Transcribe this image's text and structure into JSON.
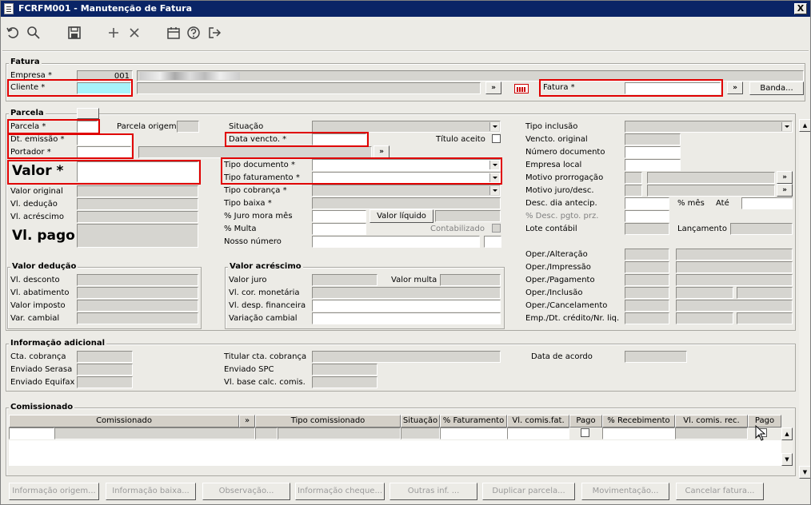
{
  "window": {
    "title": "FCRFM001 - Manutenção de Fatura",
    "close": "X"
  },
  "toolbar": {
    "icons": [
      "undo-icon",
      "search-icon",
      "save-icon",
      "add-icon",
      "delete-icon",
      "calendar-icon",
      "help-icon",
      "exit-icon"
    ]
  },
  "fatura": {
    "section": "Fatura",
    "empresa_label": "Empresa *",
    "empresa_value": "001",
    "cliente_label": "Cliente *",
    "fatura_label": "Fatura *",
    "banda_button": "Banda...",
    "lookup": "»"
  },
  "parcela": {
    "section": "Parcela",
    "parcela_label": "Parcela *",
    "parcela_origem_label": "Parcela origem",
    "dt_emissao_label": "Dt. emissão *",
    "portador_label": "Portador *",
    "valor_label": "Valor *",
    "valor_original_label": "Valor original",
    "vl_deducao_label": "Vl. dedução",
    "vl_acrescimo_label": "Vl. acréscimo",
    "vl_pago_label": "Vl. pago",
    "situacao_label": "Situação",
    "data_vencto_label": "Data vencto. *",
    "titulo_aceito_label": "Título aceito",
    "tipo_documento_label": "Tipo documento *",
    "tipo_faturamento_label": "Tipo faturamento *",
    "tipo_cobranca_label": "Tipo cobrança *",
    "tipo_baixa_label": "Tipo baixa *",
    "juro_mora_label": "% Juro mora mês",
    "valor_liquido_label": "Valor líquido",
    "multa_label": "% Multa",
    "contabilizado_label": "Contabilizado",
    "nosso_numero_label": "Nosso número",
    "tipo_inclusao_label": "Tipo inclusão",
    "vencto_original_label": "Vencto. original",
    "numero_documento_label": "Número documento",
    "empresa_local_label": "Empresa local",
    "motivo_prorrogacao_label": "Motivo prorrogação",
    "motivo_juro_label": "Motivo juro/desc.",
    "desc_dia_label": "Desc. dia antecip.",
    "pct_mes_label": "% mês",
    "ate_label": "Até",
    "pct_desc_label": "% Desc. pgto. prz.",
    "lote_contabil_label": "Lote contábil",
    "lancamento_label": "Lançamento",
    "oper_alteracao_label": "Oper./Alteração",
    "oper_impressao_label": "Oper./Impressão",
    "oper_pagamento_label": "Oper./Pagamento",
    "oper_inclusao_label": "Oper./Inclusão",
    "oper_cancelamento_label": "Oper./Cancelamento",
    "emp_dt_label": "Emp./Dt. crédito/Nr. liq."
  },
  "valor_deducao": {
    "section": "Valor dedução",
    "desconto": "Vl. desconto",
    "abatimento": "Vl. abatimento",
    "imposto": "Valor imposto",
    "var_cambial": "Var. cambial"
  },
  "valor_acrescimo": {
    "section": "Valor acréscimo",
    "juro": "Valor juro",
    "multa": "Valor multa",
    "cor_monetaria": "Vl. cor. monetária",
    "desp_financeira": "Vl. desp. financeira",
    "variacao_cambial": "Variação cambial"
  },
  "info_adicional": {
    "section": "Informação adicional",
    "cta_cobranca": "Cta. cobrança",
    "enviado_serasa": "Enviado Serasa",
    "enviado_equifax": "Enviado Equifax",
    "titular": "Titular cta. cobrança",
    "enviado_spc": "Enviado SPC",
    "vl_base": "Vl. base calc. comis.",
    "data_acordo": "Data de acordo"
  },
  "comissionado": {
    "section": "Comissionado",
    "columns": [
      "Comissionado",
      "»",
      "Tipo comissionado",
      "Situação",
      "% Faturamento",
      "Vl. comis.fat.",
      "Pago",
      "% Recebimento",
      "Vl. comis. rec.",
      "Pago"
    ]
  },
  "buttons": [
    "Informação origem...",
    "Informação baixa...",
    "Observação...",
    "Informação cheque...",
    "Outras inf. ...",
    "Duplicar parcela...",
    "Movimentação...",
    "Cancelar fatura..."
  ],
  "colors": {
    "titlebar": "#0a2466",
    "highlight": "#e00000",
    "cliente_field": "#a7f3fb",
    "background": "#ecebe6"
  }
}
